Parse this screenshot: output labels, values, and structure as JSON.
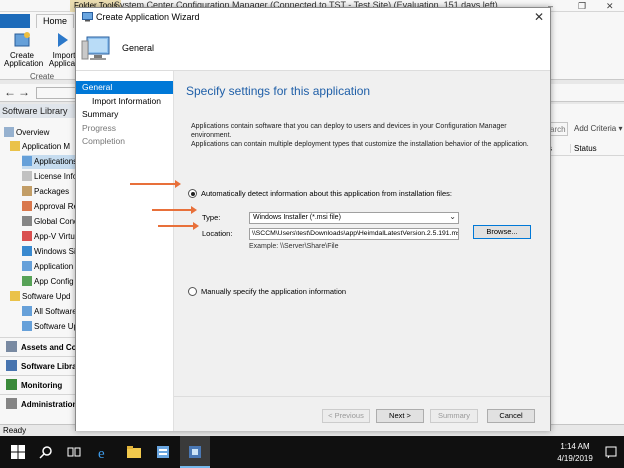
{
  "background_app": {
    "title": "System Center Configuration Manager (Connected to TST - Test Site) (Evaluation, 151 days left)",
    "contextual_tab": "Folder Tools",
    "window_controls": [
      "–",
      "❐",
      "✕"
    ],
    "ribbon_tabs": [
      "Home"
    ],
    "ribbon_buttons": [
      {
        "label_line1": "Create",
        "label_line2": "Application"
      },
      {
        "label_line1": "Import",
        "label_line2": "Applicati"
      }
    ],
    "ribbon_group": "Create",
    "nav_back": "←",
    "nav_forward": "→",
    "left_pane_title": "Software Library",
    "tree": [
      "Overview",
      "Application M",
      "Applications",
      "License Info",
      "Packages",
      "Approval Re",
      "Global Cond",
      "App-V Virtu",
      "Windows Sid",
      "Application",
      "App Config",
      "Software Upd",
      "All Software",
      "Software Up"
    ],
    "workspaces": [
      "Assets and Comp",
      "Software Librar",
      "Monitoring",
      "Administration"
    ],
    "search_placeholder": "arch",
    "add_criteria": "Add Criteria ▾",
    "columns": [
      "s",
      "Status"
    ],
    "status": "Ready"
  },
  "wizard": {
    "title": "Create Application Wizard",
    "close": "✕",
    "header_title": "General",
    "steps": [
      {
        "label": "General"
      },
      {
        "label": "Import Information"
      },
      {
        "label": "Summary"
      },
      {
        "label": "Progress"
      },
      {
        "label": "Completion"
      }
    ],
    "page_title": "Specify settings for this application",
    "description_line1": "Applications contain software that you can deploy to users and devices in your Configuration Manager environment.",
    "description_line2": "Applications can contain multiple deployment types that customize the installation behavior of the application.",
    "option_auto": "Automatically detect information about this application from installation files:",
    "type_label": "Type:",
    "type_value": "Windows Installer (*.msi file)",
    "type_chevron": "⌄",
    "location_label": "Location:",
    "location_value": "\\\\SCCM\\Users\\test\\Downloads\\app\\HeimdalLatestVersion.2.5.191.msi",
    "browse_label": "Browse...",
    "example": "Example: \\\\Server\\Share\\File",
    "option_manual": "Manually specify the application information",
    "buttons": {
      "previous": "< Previous",
      "next": "Next >",
      "summary": "Summary",
      "cancel": "Cancel"
    }
  },
  "taskbar": {
    "time": "1:14 AM",
    "date": "4/19/2019"
  },
  "colors": {
    "accent": "#0078d7",
    "page_title": "#1f5fa8",
    "annotation_arrow": "#e8703a",
    "taskbar": "#101010"
  }
}
